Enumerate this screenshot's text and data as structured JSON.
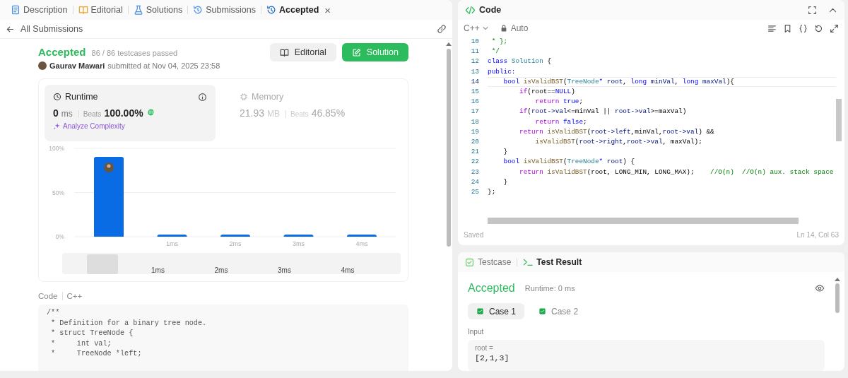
{
  "tabs": [
    {
      "label": "Description",
      "selected": false
    },
    {
      "label": "Editorial",
      "selected": false
    },
    {
      "label": "Solutions",
      "selected": false
    },
    {
      "label": "Submissions",
      "selected": false
    },
    {
      "label": "Accepted",
      "selected": true,
      "close": "×"
    }
  ],
  "back_link": "All Submissions",
  "submission": {
    "status": "Accepted",
    "passed": "86 / 86 testcases passed",
    "user": "Gaurav Mawari",
    "submitted": "submitted at Nov 04, 2025 23:58",
    "buttons": [
      {
        "label": "Editorial",
        "kind": "secondary"
      },
      {
        "label": "Solution",
        "kind": "primary"
      }
    ]
  },
  "stats": [
    {
      "label": "Runtime",
      "value": "0",
      "unit": "ms",
      "beats_label": "Beats",
      "beats": "100.00%",
      "selected": true,
      "link": "Analyze Complexity"
    },
    {
      "label": "Memory",
      "value": "21.93",
      "unit": "MB",
      "beats_label": "Beats",
      "beats": "46.85%",
      "selected": false
    }
  ],
  "chart_data": {
    "type": "bar",
    "categories": [
      null,
      "1ms",
      "2ms",
      "3ms",
      "4ms"
    ],
    "values": [
      90.4,
      2.5,
      2.5,
      2.5,
      2.5
    ],
    "ylim": [
      0,
      100
    ],
    "yticks": [
      {
        "value": 0,
        "label": "0%"
      },
      {
        "value": 50,
        "label": "50%"
      },
      {
        "value": 100,
        "label": "100%"
      }
    ]
  },
  "navigator_labels": [
    "1ms",
    "2ms",
    "3ms",
    "4ms"
  ],
  "code_header": {
    "title": "Code",
    "language": "C++"
  },
  "submitted_code": [
    "/**",
    " * Definition for a binary tree node.",
    " * struct TreeNode {",
    " *     int val;",
    " *     TreeNode *left;"
  ],
  "editor": {
    "title": "Code",
    "language": "C++",
    "mode": "Auto",
    "status": "Saved",
    "cursor": "Ln 14, Col 63",
    "lines": [
      {
        "number": "10",
        "current": false,
        "tokens": [
          {
            "text": " * };",
            "kind": "comment"
          }
        ]
      },
      {
        "number": "11",
        "current": false,
        "tokens": [
          {
            "text": " */",
            "kind": "comment"
          }
        ]
      },
      {
        "number": "12",
        "current": false,
        "tokens": [
          {
            "text": "class ",
            "kind": "keyword"
          },
          {
            "text": "Solution",
            "kind": "type"
          },
          {
            "text": " {",
            "kind": "plain"
          }
        ]
      },
      {
        "number": "13",
        "current": false,
        "tokens": [
          {
            "text": "public:",
            "kind": "keyword"
          }
        ]
      },
      {
        "number": "14",
        "current": true,
        "tokens": [
          {
            "text": "    bool ",
            "kind": "keyword"
          },
          {
            "text": "isValidBST",
            "kind": "function"
          },
          {
            "text": "(",
            "kind": "plain"
          },
          {
            "text": "TreeNode",
            "kind": "type"
          },
          {
            "text": "* ",
            "kind": "keyword"
          },
          {
            "text": "root",
            "kind": "variable"
          },
          {
            "text": ", ",
            "kind": "plain"
          },
          {
            "text": "long ",
            "kind": "keyword"
          },
          {
            "text": "minVal",
            "kind": "variable"
          },
          {
            "text": ", ",
            "kind": "plain"
          },
          {
            "text": "long ",
            "kind": "keyword"
          },
          {
            "text": "maxVal",
            "kind": "variable"
          },
          {
            "text": "){",
            "kind": "plain"
          }
        ]
      },
      {
        "number": "15",
        "current": false,
        "tokens": [
          {
            "text": "        if",
            "kind": "control"
          },
          {
            "text": "(root==",
            "kind": "plain"
          },
          {
            "text": "NULL",
            "kind": "keyword"
          },
          {
            "text": ")",
            "kind": "plain"
          }
        ]
      },
      {
        "number": "16",
        "current": false,
        "tokens": [
          {
            "text": "            return ",
            "kind": "control"
          },
          {
            "text": "true",
            "kind": "keyword"
          },
          {
            "text": ";",
            "kind": "plain"
          }
        ]
      },
      {
        "number": "17",
        "current": false,
        "tokens": [
          {
            "text": "        if",
            "kind": "control"
          },
          {
            "text": "(",
            "kind": "plain"
          },
          {
            "text": "root->val",
            "kind": "variable"
          },
          {
            "text": "<=minVal || ",
            "kind": "plain"
          },
          {
            "text": "root->val",
            "kind": "variable"
          },
          {
            "text": ">=maxVal)",
            "kind": "plain"
          }
        ]
      },
      {
        "number": "18",
        "current": false,
        "tokens": [
          {
            "text": "            return ",
            "kind": "control"
          },
          {
            "text": "false",
            "kind": "keyword"
          },
          {
            "text": ";",
            "kind": "plain"
          }
        ]
      },
      {
        "number": "19",
        "current": false,
        "tokens": [
          {
            "text": "        return ",
            "kind": "control"
          },
          {
            "text": "isValidBST",
            "kind": "function"
          },
          {
            "text": "(",
            "kind": "plain"
          },
          {
            "text": "root->left",
            "kind": "variable"
          },
          {
            "text": ",minVal,",
            "kind": "plain"
          },
          {
            "text": "root->val",
            "kind": "variable"
          },
          {
            "text": ") &&",
            "kind": "plain"
          }
        ]
      },
      {
        "number": "20",
        "current": false,
        "tokens": [
          {
            "text": "            isValidBST",
            "kind": "function"
          },
          {
            "text": "(",
            "kind": "plain"
          },
          {
            "text": "root->right",
            "kind": "variable"
          },
          {
            "text": ",",
            "kind": "plain"
          },
          {
            "text": "root->val",
            "kind": "variable"
          },
          {
            "text": ", maxVal);",
            "kind": "plain"
          }
        ]
      },
      {
        "number": "21",
        "current": false,
        "tokens": [
          {
            "text": "    }",
            "kind": "plain"
          }
        ]
      },
      {
        "number": "22",
        "current": false,
        "tokens": [
          {
            "text": "    bool ",
            "kind": "keyword"
          },
          {
            "text": "isValidBST",
            "kind": "function"
          },
          {
            "text": "(",
            "kind": "plain"
          },
          {
            "text": "TreeNode",
            "kind": "type"
          },
          {
            "text": "* ",
            "kind": "keyword"
          },
          {
            "text": "root",
            "kind": "variable"
          },
          {
            "text": ") {",
            "kind": "plain"
          }
        ]
      },
      {
        "number": "23",
        "current": false,
        "tokens": [
          {
            "text": "        return ",
            "kind": "control"
          },
          {
            "text": "isValidBST",
            "kind": "function"
          },
          {
            "text": "(root, LONG_MIN, LONG_MAX);    ",
            "kind": "plain"
          },
          {
            "text": "//O(n)  //O(n) aux. stack space",
            "kind": "comment"
          }
        ]
      },
      {
        "number": "24",
        "current": false,
        "tokens": [
          {
            "text": "    }",
            "kind": "plain"
          }
        ]
      },
      {
        "number": "25",
        "current": false,
        "tokens": [
          {
            "text": "};",
            "kind": "plain"
          }
        ]
      }
    ]
  },
  "test_panel": {
    "tabs": [
      {
        "label": "Testcase",
        "selected": false
      },
      {
        "label": "Test Result",
        "selected": true
      }
    ],
    "status": "Accepted",
    "runtime": "Runtime: 0 ms",
    "cases": [
      {
        "label": "Case 1",
        "selected": true
      },
      {
        "label": "Case 2",
        "selected": false
      }
    ],
    "input_label": "Input",
    "input_name": "root =",
    "input_value": "[2,1,3]"
  }
}
